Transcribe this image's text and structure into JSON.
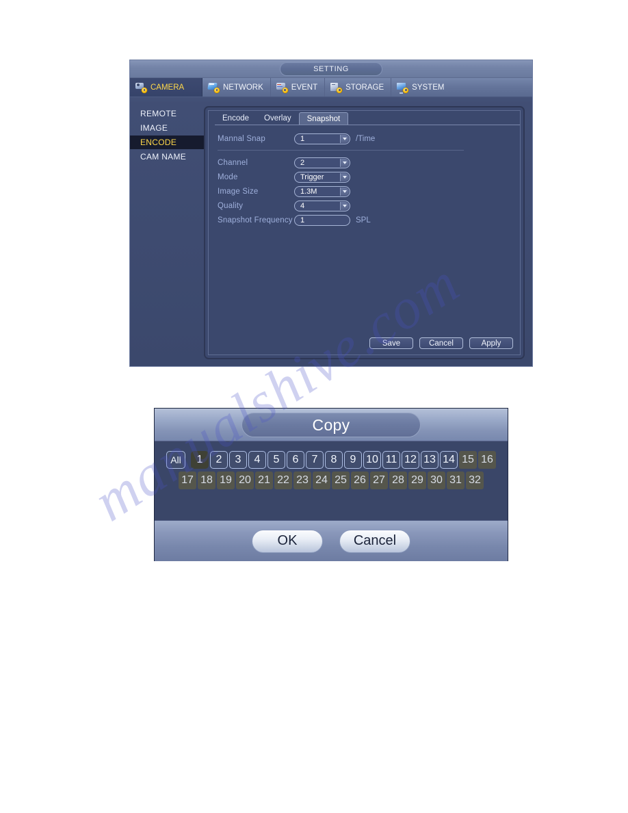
{
  "setting_window": {
    "title": "SETTING",
    "top_nav": [
      {
        "label": "CAMERA",
        "icon": "camera-icon",
        "active": true
      },
      {
        "label": "NETWORK",
        "icon": "network-icon",
        "active": false
      },
      {
        "label": "EVENT",
        "icon": "event-icon",
        "active": false
      },
      {
        "label": "STORAGE",
        "icon": "storage-icon",
        "active": false
      },
      {
        "label": "SYSTEM",
        "icon": "system-icon",
        "active": false
      }
    ],
    "sidebar": [
      {
        "label": "REMOTE",
        "active": false
      },
      {
        "label": "IMAGE",
        "active": false
      },
      {
        "label": "ENCODE",
        "active": true
      },
      {
        "label": "CAM NAME",
        "active": false
      }
    ],
    "tabs": [
      {
        "label": "Encode",
        "active": false
      },
      {
        "label": "Overlay",
        "active": false
      },
      {
        "label": "Snapshot",
        "active": true
      }
    ],
    "form": {
      "manual_snap": {
        "label": "Mannal Snap",
        "value": "1",
        "unit": "/Time",
        "control": "dropdown"
      },
      "channel": {
        "label": "Channel",
        "value": "2",
        "unit": "",
        "control": "dropdown"
      },
      "mode": {
        "label": "Mode",
        "value": "Trigger",
        "unit": "",
        "control": "dropdown"
      },
      "image_size": {
        "label": "Image Size",
        "value": "1.3M",
        "unit": "",
        "control": "dropdown"
      },
      "quality": {
        "label": "Quality",
        "value": "4",
        "unit": "",
        "control": "dropdown"
      },
      "snapshot_frequency": {
        "label": "Snapshot Frequency",
        "value": "1",
        "unit": "SPL",
        "control": "text"
      }
    },
    "buttons": [
      {
        "label": "Save"
      },
      {
        "label": "Cancel"
      },
      {
        "label": "Apply"
      }
    ]
  },
  "copy_dialog": {
    "title": "Copy",
    "all_label": "All",
    "channels_row1": [
      {
        "label": "1",
        "state": "selected"
      },
      {
        "label": "2",
        "state": "enabled"
      },
      {
        "label": "3",
        "state": "enabled"
      },
      {
        "label": "4",
        "state": "enabled"
      },
      {
        "label": "5",
        "state": "enabled"
      },
      {
        "label": "6",
        "state": "enabled"
      },
      {
        "label": "7",
        "state": "enabled"
      },
      {
        "label": "8",
        "state": "enabled"
      },
      {
        "label": "9",
        "state": "enabled"
      },
      {
        "label": "10",
        "state": "enabled"
      },
      {
        "label": "11",
        "state": "enabled"
      },
      {
        "label": "12",
        "state": "enabled"
      },
      {
        "label": "13",
        "state": "enabled"
      },
      {
        "label": "14",
        "state": "enabled"
      },
      {
        "label": "15",
        "state": "disabled"
      },
      {
        "label": "16",
        "state": "disabled"
      }
    ],
    "channels_row2": [
      {
        "label": "17",
        "state": "disabled"
      },
      {
        "label": "18",
        "state": "disabled"
      },
      {
        "label": "19",
        "state": "disabled"
      },
      {
        "label": "20",
        "state": "disabled"
      },
      {
        "label": "21",
        "state": "disabled"
      },
      {
        "label": "22",
        "state": "disabled"
      },
      {
        "label": "23",
        "state": "disabled"
      },
      {
        "label": "24",
        "state": "disabled"
      },
      {
        "label": "25",
        "state": "disabled"
      },
      {
        "label": "26",
        "state": "disabled"
      },
      {
        "label": "27",
        "state": "disabled"
      },
      {
        "label": "28",
        "state": "disabled"
      },
      {
        "label": "29",
        "state": "disabled"
      },
      {
        "label": "30",
        "state": "disabled"
      },
      {
        "label": "31",
        "state": "disabled"
      },
      {
        "label": "32",
        "state": "disabled"
      }
    ],
    "buttons": [
      {
        "label": "OK"
      },
      {
        "label": "Cancel"
      }
    ]
  },
  "watermark": {
    "text": "manualshive.com"
  },
  "colors": {
    "accent_yellow": "#ffd84a",
    "panel_bg": "#3b486d",
    "label_blue": "#9fb0dc",
    "watermark": "#4a52c8"
  }
}
